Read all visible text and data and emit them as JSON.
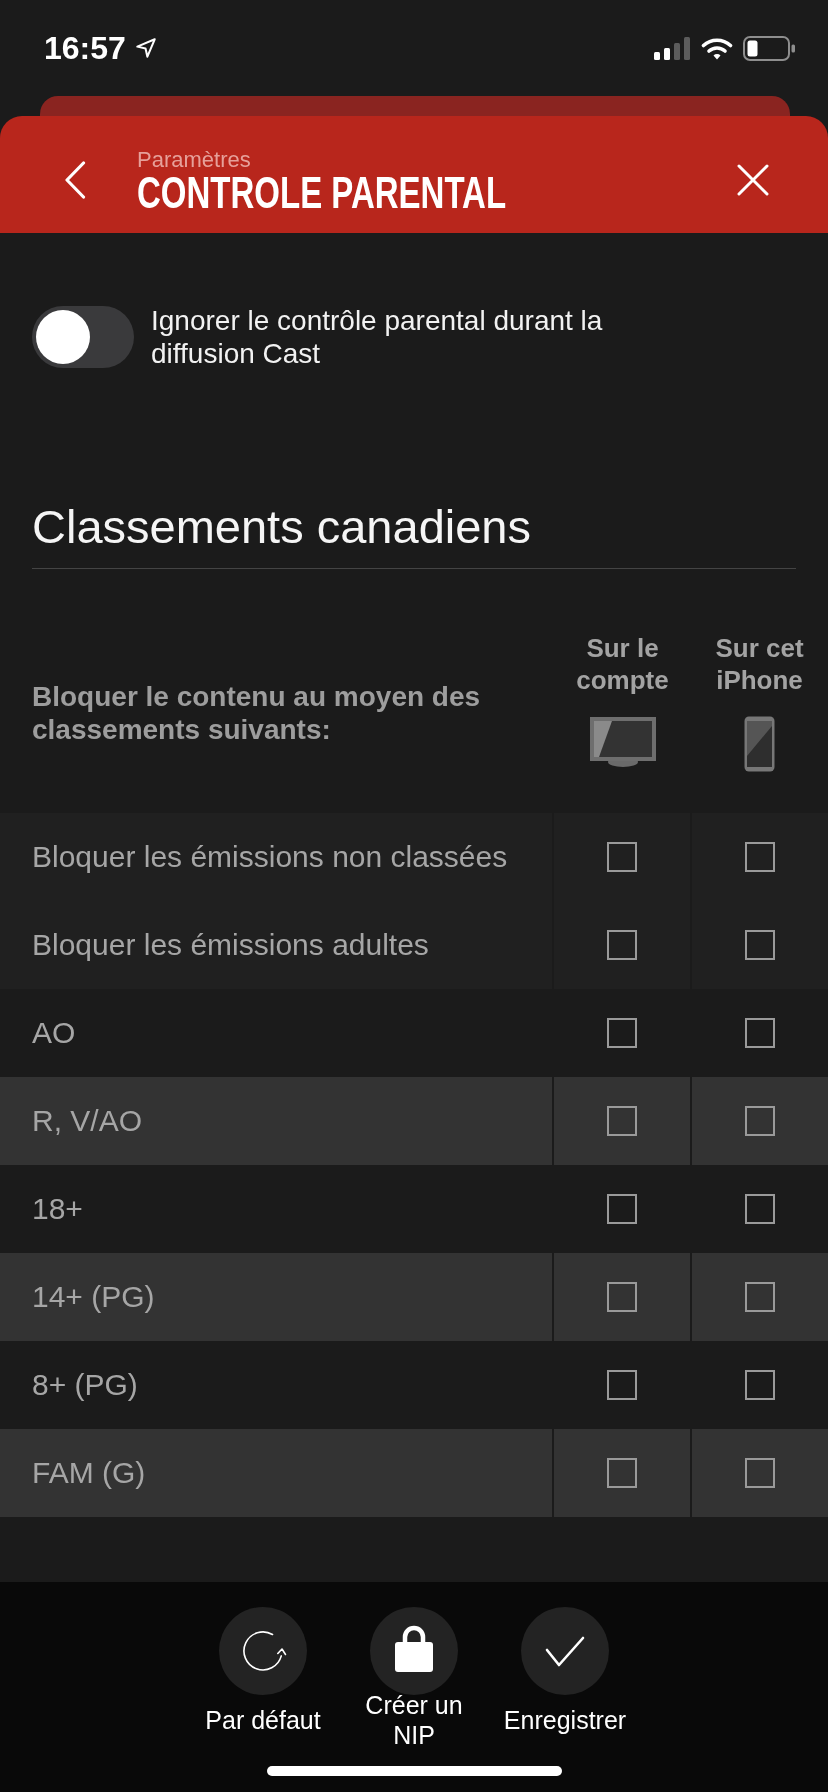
{
  "status_bar": {
    "time": "16:57"
  },
  "header": {
    "subtitle": "Paramètres",
    "title": "CONTROLE PARENTAL"
  },
  "cast_toggle": {
    "label": "Ignorer le contrôle parental durant la diffusion Cast",
    "on": false
  },
  "section": {
    "title": "Classements canadiens"
  },
  "table": {
    "caption": "Bloquer le contenu au moyen des classements suivants:",
    "columns": [
      {
        "label": "Sur le compte",
        "kind": "account"
      },
      {
        "label": "Sur cet iPhone",
        "kind": "device"
      }
    ],
    "rows": [
      {
        "kind": "option",
        "label": "Bloquer les émissions non classées",
        "checks": [
          {
            "checked": false
          },
          {
            "checked": false
          }
        ]
      },
      {
        "kind": "option",
        "label": "Bloquer les émissions adultes",
        "checks": [
          {
            "checked": false
          },
          {
            "checked": false
          }
        ]
      },
      {
        "kind": "rating",
        "label": "AO",
        "checks": [
          {
            "checked": false
          },
          {
            "checked": false
          }
        ]
      },
      {
        "kind": "rating",
        "label": "R, V/AO",
        "checks": [
          {
            "checked": false
          },
          {
            "checked": false
          }
        ]
      },
      {
        "kind": "rating",
        "label": "18+",
        "checks": [
          {
            "checked": false
          },
          {
            "checked": false
          }
        ]
      },
      {
        "kind": "rating",
        "label": "14+ (PG)",
        "checks": [
          {
            "checked": false
          },
          {
            "checked": false
          }
        ]
      },
      {
        "kind": "rating",
        "label": "8+ (PG)",
        "checks": [
          {
            "checked": false
          },
          {
            "checked": false
          }
        ]
      },
      {
        "kind": "rating",
        "label": "FAM (G)",
        "checks": [
          {
            "checked": false
          },
          {
            "checked": false
          }
        ]
      }
    ]
  },
  "actions": [
    {
      "kind": "reset",
      "label": "Par défaut"
    },
    {
      "kind": "pin",
      "label": "Créer un NIP"
    },
    {
      "kind": "save",
      "label": "Enregistrer"
    }
  ]
}
